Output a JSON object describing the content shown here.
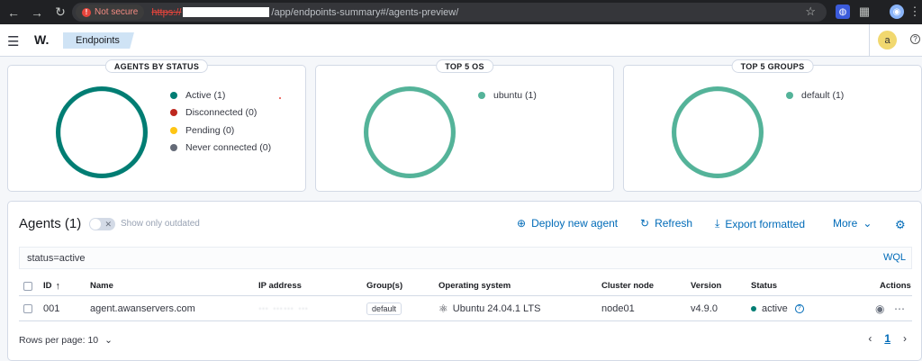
{
  "browser": {
    "not_secure": "Not secure",
    "url_scheme": "https://",
    "url_path": "/app/endpoints-summary#/agents-preview/"
  },
  "header": {
    "brand": "W.",
    "breadcrumb": "Endpoints",
    "avatar_initial": "a",
    "help": "?"
  },
  "panels": {
    "status": {
      "title": "AGENTS BY STATUS",
      "legend": [
        {
          "label": "Active (1)",
          "color": "#017d73"
        },
        {
          "label": "Disconnected (0)",
          "color": "#bd271e"
        },
        {
          "label": "Pending (0)",
          "color": "#fec514"
        },
        {
          "label": "Never connected (0)",
          "color": "#646a77"
        }
      ],
      "ring_color": "#017d73"
    },
    "os": {
      "title": "TOP 5 OS",
      "legend": [
        {
          "label": "ubuntu (1)",
          "color": "#54b399"
        }
      ],
      "ring_color": "#54b399"
    },
    "groups": {
      "title": "TOP 5 GROUPS",
      "legend": [
        {
          "label": "default (1)",
          "color": "#54b399"
        }
      ],
      "ring_color": "#54b399"
    }
  },
  "agents": {
    "title": "Agents (1)",
    "show_outdated": "Show only outdated",
    "deploy": "Deploy new agent",
    "refresh": "Refresh",
    "export": "Export formatted",
    "more": "More",
    "search_value": "status=active",
    "wql": "WQL",
    "columns": {
      "id": "ID",
      "name": "Name",
      "ip": "IP address",
      "groups": "Group(s)",
      "os": "Operating system",
      "cluster": "Cluster node",
      "version": "Version",
      "status": "Status",
      "actions": "Actions"
    },
    "rows": [
      {
        "id": "001",
        "name": "agent.awanservers.com",
        "ip": "",
        "group": "default",
        "os": "Ubuntu 24.04.1 LTS",
        "cluster": "node01",
        "version": "v4.9.0",
        "status": "active"
      }
    ],
    "rows_per_page": "Rows per page: 10",
    "current_page": "1"
  }
}
